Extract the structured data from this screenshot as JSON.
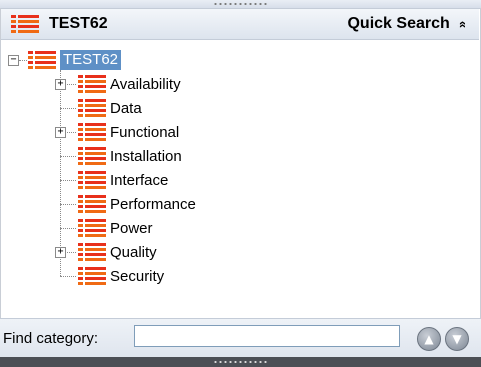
{
  "header": {
    "title": "TEST62",
    "quick_search_label": "Quick Search",
    "collapse_glyph": "»",
    "icon": "list-icon"
  },
  "tree": {
    "root": {
      "label": "TEST62",
      "expanded": true,
      "selected": true
    },
    "items": [
      {
        "label": "Availability",
        "has_children": true
      },
      {
        "label": "Data",
        "has_children": false
      },
      {
        "label": "Functional",
        "has_children": true
      },
      {
        "label": "Installation",
        "has_children": false
      },
      {
        "label": "Interface",
        "has_children": false
      },
      {
        "label": "Performance",
        "has_children": false
      },
      {
        "label": "Power",
        "has_children": false
      },
      {
        "label": "Quality",
        "has_children": true
      },
      {
        "label": "Security",
        "has_children": false
      }
    ],
    "expand_glyph": "+",
    "collapse_glyph": "−"
  },
  "footer": {
    "find_label": "Find category:",
    "find_value": "",
    "prev_icon": "up-arrow-icon",
    "next_icon": "down-arrow-icon"
  },
  "colors": {
    "selection": "#5e90c6",
    "icon_red": "#e8301b",
    "icon_orange": "#f06a14"
  }
}
